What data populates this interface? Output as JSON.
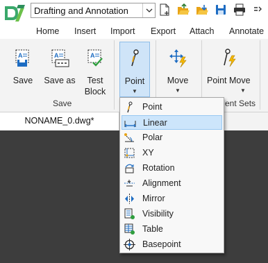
{
  "workspace": {
    "selected": "Drafting and Annotation"
  },
  "quick_access": {
    "icons": [
      "new-drawing-icon",
      "open-icon",
      "open-folder-icon",
      "save-icon",
      "print-icon",
      "more-icon"
    ]
  },
  "menu_tabs": [
    "Home",
    "Insert",
    "Import",
    "Export",
    "Attach",
    "Annotate"
  ],
  "ribbon": {
    "save_group": {
      "label": "Save",
      "buttons": [
        {
          "label": "Save",
          "icon": "save-block-icon"
        },
        {
          "label": "Save as",
          "icon": "save-as-block-icon"
        },
        {
          "label": "Test Block",
          "icon": "test-block-icon",
          "lines": [
            "Test",
            "Block"
          ]
        }
      ]
    },
    "point_button": {
      "label": "Point",
      "icon": "point-param-icon"
    },
    "move_button": {
      "label": "Move",
      "icon": "move-action-icon"
    },
    "point_move_button": {
      "label": "Point Move",
      "icon": "point-move-icon"
    },
    "partial_group_label": "ent Sets"
  },
  "document_tab": {
    "title": "NONAME_0.dwg*"
  },
  "accent": "#1d6cc2",
  "dropdown": {
    "items": [
      {
        "label": "Point",
        "icon": "point-icon",
        "highlighted": false
      },
      {
        "label": "Linear",
        "icon": "linear-icon",
        "highlighted": true
      },
      {
        "label": "Polar",
        "icon": "polar-icon",
        "highlighted": false
      },
      {
        "label": "XY",
        "icon": "xy-icon",
        "highlighted": false
      },
      {
        "label": "Rotation",
        "icon": "rotation-icon",
        "highlighted": false
      },
      {
        "label": "Alignment",
        "icon": "alignment-icon",
        "highlighted": false
      },
      {
        "label": "Mirror",
        "icon": "mirror-icon",
        "highlighted": false
      },
      {
        "label": "Visibility",
        "icon": "visibility-icon",
        "highlighted": false
      },
      {
        "label": "Table",
        "icon": "table-icon",
        "highlighted": false
      },
      {
        "label": "Basepoint",
        "icon": "basepoint-icon",
        "highlighted": false
      }
    ]
  }
}
